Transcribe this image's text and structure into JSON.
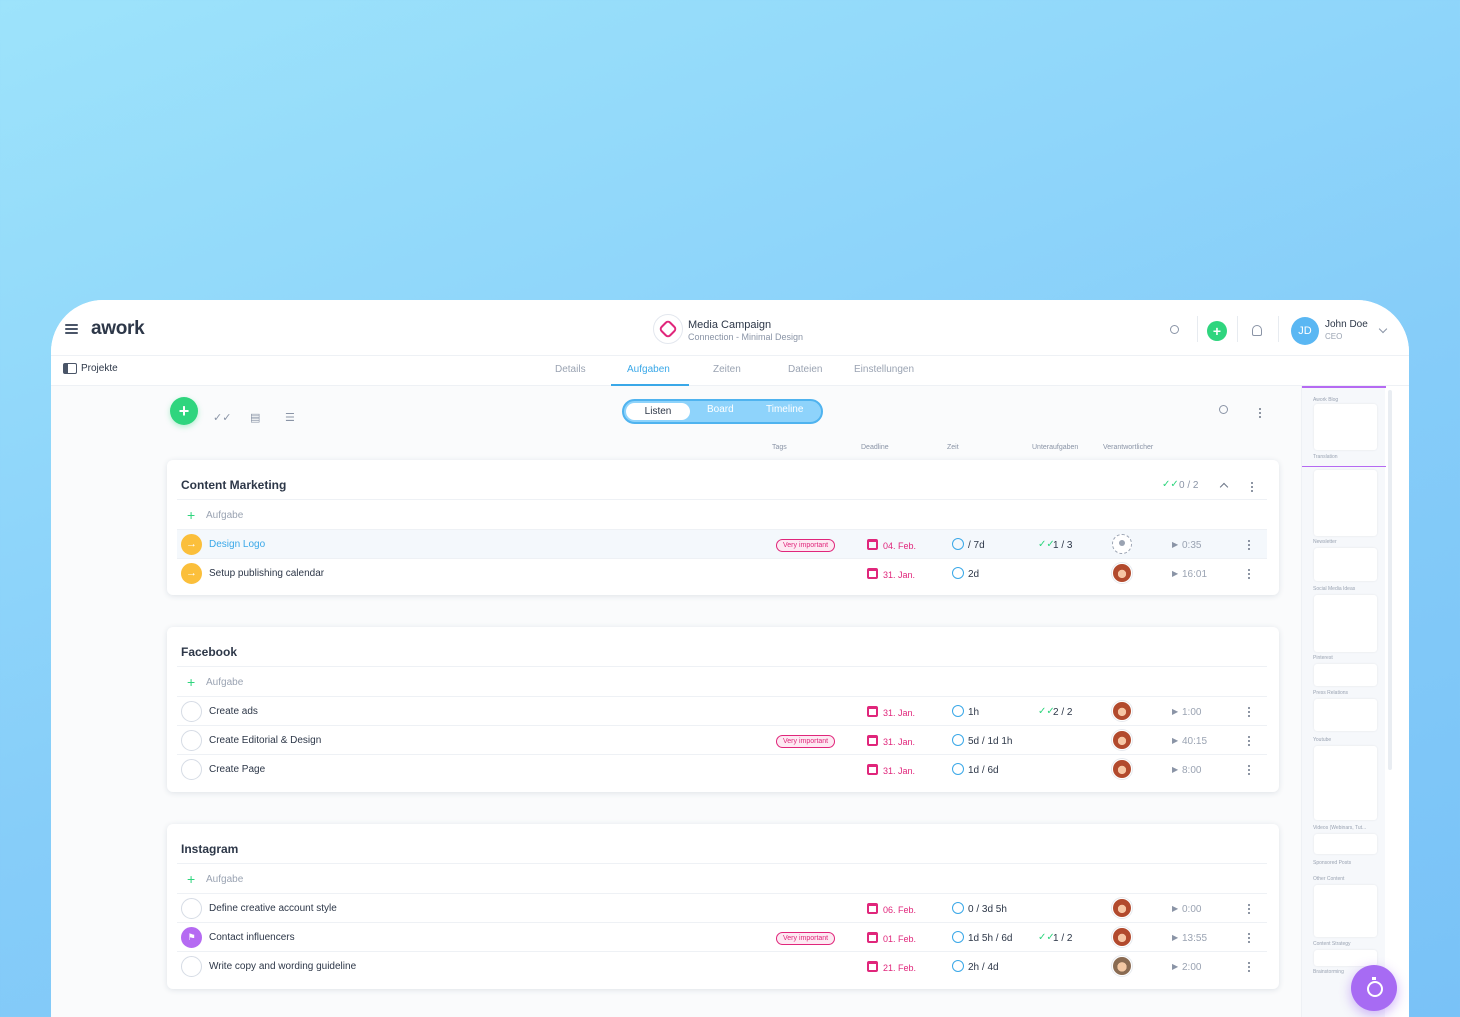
{
  "app": {
    "logo": "awork"
  },
  "project": {
    "title": "Media Campaign",
    "subtitle": "Connection - Minimal Design"
  },
  "user": {
    "initials": "JD",
    "name": "John Doe",
    "role": "CEO"
  },
  "nav": {
    "projects_link": "Projekte",
    "tabs": [
      "Details",
      "Aufgaben",
      "Zeiten",
      "Dateien",
      "Einstellungen"
    ],
    "active_tab": "Aufgaben"
  },
  "view_switch": [
    "Listen",
    "Board",
    "Timeline"
  ],
  "columns": [
    "Tags",
    "Deadline",
    "Zeit",
    "Unteraufgaben",
    "Verantwortlicher"
  ],
  "add_task_label": "Aufgabe",
  "lists": [
    {
      "title": "Content Marketing",
      "progress": "0 / 2",
      "tasks": [
        {
          "name": "Design Logo",
          "status": "in-progress",
          "tag": "Very important",
          "deadline": "04. Feb.",
          "time": "/ 7d",
          "subtasks": "1 / 3",
          "assignee": "none",
          "tracked": "0:35"
        },
        {
          "name": "Setup publishing calendar",
          "status": "in-progress",
          "tag": "",
          "deadline": "31. Jan.",
          "time": "2d",
          "subtasks": "",
          "assignee": "woman",
          "tracked": "16:01"
        }
      ]
    },
    {
      "title": "Facebook",
      "tasks": [
        {
          "name": "Create ads",
          "status": "open",
          "tag": "",
          "deadline": "31. Jan.",
          "time": "1h",
          "subtasks": "2 / 2",
          "assignee": "woman",
          "tracked": "1:00"
        },
        {
          "name": "Create Editorial & Design",
          "status": "open",
          "tag": "Very important",
          "deadline": "31. Jan.",
          "time": "5d / 1d 1h",
          "subtasks": "",
          "assignee": "woman",
          "tracked": "40:15"
        },
        {
          "name": "Create Page",
          "status": "open",
          "tag": "",
          "deadline": "31. Jan.",
          "time": "1d / 6d",
          "subtasks": "",
          "assignee": "woman",
          "tracked": "8:00"
        }
      ]
    },
    {
      "title": "Instagram",
      "tasks": [
        {
          "name": "Define creative account style",
          "status": "open",
          "tag": "",
          "deadline": "06. Feb.",
          "time": "0 / 3d 5h",
          "subtasks": "",
          "assignee": "woman",
          "tracked": "0:00"
        },
        {
          "name": "Contact influencers",
          "status": "flagged",
          "tag": "Very important",
          "deadline": "01. Feb.",
          "time": "1d 5h / 6d",
          "subtasks": "1 / 2",
          "assignee": "woman",
          "tracked": "13:55"
        },
        {
          "name": "Write copy and wording guideline",
          "status": "open",
          "tag": "",
          "deadline": "21. Feb.",
          "time": "2h / 4d",
          "subtasks": "",
          "assignee": "man",
          "tracked": "2:00"
        }
      ]
    }
  ],
  "mini_board": [
    "Awork Blog",
    "Translation",
    "Newsletter",
    "Social Media Ideas",
    "Pinterest",
    "Press Relations",
    "Youtube",
    "Videos (Webinars, Tut...",
    "Sponsored Posts",
    "Other Content",
    "Content Strategy",
    "Brainstorming"
  ],
  "colors": {
    "accent": "#3aa8e8",
    "green": "#2fd57e",
    "pink": "#e0267b",
    "purple": "#a76bf3",
    "orange": "#fbbf3b"
  }
}
